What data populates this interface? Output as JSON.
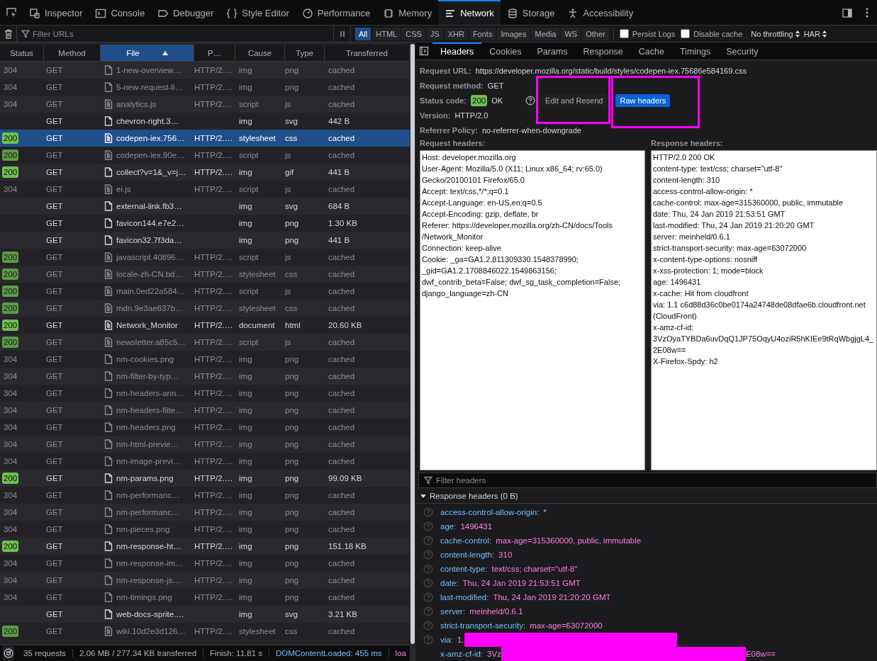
{
  "toolbar": {
    "tabs": [
      {
        "label": "Inspector",
        "selected": false
      },
      {
        "label": "Console",
        "selected": false
      },
      {
        "label": "Debugger",
        "selected": false
      },
      {
        "label": "Style Editor",
        "selected": false
      },
      {
        "label": "Performance",
        "selected": false
      },
      {
        "label": "Memory",
        "selected": false
      },
      {
        "label": "Network",
        "selected": true
      },
      {
        "label": "Storage",
        "selected": false
      },
      {
        "label": "Accessibility",
        "selected": false
      }
    ]
  },
  "filter_bar": {
    "placeholder": "Filter URLs",
    "types": [
      {
        "label": "All",
        "selected": true
      },
      {
        "label": "HTML",
        "selected": false
      },
      {
        "label": "CSS",
        "selected": false
      },
      {
        "label": "JS",
        "selected": false
      },
      {
        "label": "XHR",
        "selected": false
      },
      {
        "label": "Fonts",
        "selected": false
      },
      {
        "label": "Images",
        "selected": false
      },
      {
        "label": "Media",
        "selected": false
      },
      {
        "label": "WS",
        "selected": false
      },
      {
        "label": "Other",
        "selected": false
      }
    ],
    "options": [
      {
        "label": "Persist Logs",
        "checked": false
      },
      {
        "label": "Disable cache",
        "checked": false
      }
    ],
    "throttling": "No throttling",
    "har": "HAR"
  },
  "requests": {
    "columns": [
      {
        "label": "Status",
        "sorted": false
      },
      {
        "label": "Method",
        "sorted": false
      },
      {
        "label": "File",
        "sorted": true
      },
      {
        "label": "P…",
        "sorted": false
      },
      {
        "label": "Cause",
        "sorted": false
      },
      {
        "label": "Type",
        "sorted": false
      },
      {
        "label": "Transferred",
        "sorted": false
      }
    ],
    "rows": [
      {
        "status": "304",
        "badge": false,
        "method": "GET",
        "kind": "image",
        "file": "1-new-overview…",
        "protocol": "HTTP/2.…",
        "cause": "img",
        "type": "png",
        "transferred": "cached",
        "faded": true,
        "selected": false
      },
      {
        "status": "304",
        "badge": false,
        "method": "GET",
        "kind": "image",
        "file": "5-new-request-li…",
        "protocol": "HTTP/2.…",
        "cause": "img",
        "type": "png",
        "transferred": "cached",
        "faded": true,
        "selected": false
      },
      {
        "status": "304",
        "badge": false,
        "method": "GET",
        "kind": "text",
        "file": "analytics.js",
        "protocol": "HTTP/2.…",
        "cause": "script",
        "type": "js",
        "transferred": "cached",
        "faded": true,
        "selected": false
      },
      {
        "status": "",
        "method": "GET",
        "kind": "image",
        "file": "chevron-right.3…",
        "protocol": "",
        "cause": "img",
        "type": "svg",
        "transferred": "442 B",
        "faded": false,
        "selected": false
      },
      {
        "status": "200",
        "badge": true,
        "method": "GET",
        "kind": "text",
        "file": "codepen-iex.756…",
        "protocol": "HTTP/2.…",
        "cause": "stylesheet",
        "type": "css",
        "transferred": "cached",
        "faded": false,
        "selected": true
      },
      {
        "status": "200",
        "badge": true,
        "method": "GET",
        "kind": "text",
        "file": "codepen-iex.90e…",
        "protocol": "HTTP/2.…",
        "cause": "script",
        "type": "js",
        "transferred": "cached",
        "faded": true,
        "selected": false
      },
      {
        "status": "200",
        "badge": true,
        "method": "GET",
        "kind": "image",
        "file": "collect?v=1&_v=j…",
        "protocol": "HTTP/2.…",
        "cause": "img",
        "type": "gif",
        "transferred": "441 B",
        "faded": false,
        "selected": false
      },
      {
        "status": "304",
        "badge": false,
        "method": "GET",
        "kind": "text",
        "file": "ei.js",
        "protocol": "HTTP/2.…",
        "cause": "script",
        "type": "js",
        "transferred": "cached",
        "faded": true,
        "selected": false
      },
      {
        "status": "",
        "method": "GET",
        "kind": "image",
        "file": "external-link.fb3…",
        "protocol": "",
        "cause": "img",
        "type": "svg",
        "transferred": "684 B",
        "faded": false,
        "selected": false
      },
      {
        "status": "",
        "method": "GET",
        "kind": "image",
        "file": "favicon144.e7e2…",
        "protocol": "",
        "cause": "img",
        "type": "png",
        "transferred": "1.30 KB",
        "faded": false,
        "selected": false
      },
      {
        "status": "",
        "method": "GET",
        "kind": "image",
        "file": "favicon32.7f3da…",
        "protocol": "",
        "cause": "img",
        "type": "png",
        "transferred": "441 B",
        "faded": false,
        "selected": false
      },
      {
        "status": "200",
        "badge": true,
        "method": "GET",
        "kind": "text",
        "file": "javascript.40896…",
        "protocol": "HTTP/2.…",
        "cause": "script",
        "type": "js",
        "transferred": "cached",
        "faded": true,
        "selected": false
      },
      {
        "status": "200",
        "badge": true,
        "method": "GET",
        "kind": "text",
        "file": "locale-zh-CN.bd…",
        "protocol": "HTTP/2.…",
        "cause": "stylesheet",
        "type": "css",
        "transferred": "cached",
        "faded": true,
        "selected": false
      },
      {
        "status": "200",
        "badge": true,
        "method": "GET",
        "kind": "text",
        "file": "main.0ed22a584…",
        "protocol": "HTTP/2.…",
        "cause": "script",
        "type": "js",
        "transferred": "cached",
        "faded": true,
        "selected": false
      },
      {
        "status": "200",
        "badge": true,
        "method": "GET",
        "kind": "text",
        "file": "mdn.9e3ae837b…",
        "protocol": "HTTP/2.…",
        "cause": "stylesheet",
        "type": "css",
        "transferred": "cached",
        "faded": true,
        "selected": false
      },
      {
        "status": "200",
        "badge": true,
        "method": "GET",
        "kind": "text",
        "file": "Network_Monitor",
        "protocol": "HTTP/2.…",
        "cause": "document",
        "type": "html",
        "transferred": "20.60 KB",
        "faded": false,
        "selected": false
      },
      {
        "status": "200",
        "badge": true,
        "method": "GET",
        "kind": "text",
        "file": "newsletter.a85c5…",
        "protocol": "HTTP/2.…",
        "cause": "script",
        "type": "js",
        "transferred": "cached",
        "faded": true,
        "selected": false
      },
      {
        "status": "304",
        "badge": false,
        "method": "GET",
        "kind": "image",
        "file": "nm-cookies.png",
        "protocol": "HTTP/2.…",
        "cause": "img",
        "type": "png",
        "transferred": "cached",
        "faded": true,
        "selected": false
      },
      {
        "status": "304",
        "badge": false,
        "method": "GET",
        "kind": "image",
        "file": "nm-filter-by-typ…",
        "protocol": "HTTP/2.…",
        "cause": "img",
        "type": "png",
        "transferred": "cached",
        "faded": true,
        "selected": false
      },
      {
        "status": "304",
        "badge": false,
        "method": "GET",
        "kind": "image",
        "file": "nm-headers-ann…",
        "protocol": "HTTP/2.…",
        "cause": "img",
        "type": "png",
        "transferred": "cached",
        "faded": true,
        "selected": false
      },
      {
        "status": "304",
        "badge": false,
        "method": "GET",
        "kind": "image",
        "file": "nm-headers-filte…",
        "protocol": "HTTP/2.…",
        "cause": "img",
        "type": "png",
        "transferred": "cached",
        "faded": true,
        "selected": false
      },
      {
        "status": "304",
        "badge": false,
        "method": "GET",
        "kind": "image",
        "file": "nm-headers.png",
        "protocol": "HTTP/2.…",
        "cause": "img",
        "type": "png",
        "transferred": "cached",
        "faded": true,
        "selected": false
      },
      {
        "status": "304",
        "badge": false,
        "method": "GET",
        "kind": "image",
        "file": "nm-html-previe…",
        "protocol": "HTTP/2.…",
        "cause": "img",
        "type": "png",
        "transferred": "cached",
        "faded": true,
        "selected": false
      },
      {
        "status": "304",
        "badge": false,
        "method": "GET",
        "kind": "image",
        "file": "nm-image-previ…",
        "protocol": "HTTP/2.…",
        "cause": "img",
        "type": "png",
        "transferred": "cached",
        "faded": true,
        "selected": false
      },
      {
        "status": "200",
        "badge": true,
        "method": "GET",
        "kind": "image",
        "file": "nm-params.png",
        "protocol": "HTTP/2.…",
        "cause": "img",
        "type": "png",
        "transferred": "99.09 KB",
        "faded": false,
        "selected": false
      },
      {
        "status": "304",
        "badge": false,
        "method": "GET",
        "kind": "image",
        "file": "nm-performanc…",
        "protocol": "HTTP/2.…",
        "cause": "img",
        "type": "png",
        "transferred": "cached",
        "faded": true,
        "selected": false
      },
      {
        "status": "304",
        "badge": false,
        "method": "GET",
        "kind": "image",
        "file": "nm-performanc…",
        "protocol": "HTTP/2.…",
        "cause": "img",
        "type": "png",
        "transferred": "cached",
        "faded": true,
        "selected": false
      },
      {
        "status": "304",
        "badge": false,
        "method": "GET",
        "kind": "image",
        "file": "nm-pieces.png",
        "protocol": "HTTP/2.…",
        "cause": "img",
        "type": "png",
        "transferred": "cached",
        "faded": true,
        "selected": false
      },
      {
        "status": "200",
        "badge": true,
        "method": "GET",
        "kind": "image",
        "file": "nm-response-ht…",
        "protocol": "HTTP/2.…",
        "cause": "img",
        "type": "png",
        "transferred": "151.18 KB",
        "faded": false,
        "selected": false
      },
      {
        "status": "304",
        "badge": false,
        "method": "GET",
        "kind": "image",
        "file": "nm-response-im…",
        "protocol": "HTTP/2.…",
        "cause": "img",
        "type": "png",
        "transferred": "cached",
        "faded": true,
        "selected": false
      },
      {
        "status": "304",
        "badge": false,
        "method": "GET",
        "kind": "image",
        "file": "nm-response-js…",
        "protocol": "HTTP/2.…",
        "cause": "img",
        "type": "png",
        "transferred": "cached",
        "faded": true,
        "selected": false
      },
      {
        "status": "304",
        "badge": false,
        "method": "GET",
        "kind": "image",
        "file": "nm-timings.png",
        "protocol": "HTTP/2.…",
        "cause": "img",
        "type": "png",
        "transferred": "cached",
        "faded": true,
        "selected": false
      },
      {
        "status": "",
        "method": "GET",
        "kind": "image",
        "file": "web-docs-sprite.…",
        "protocol": "",
        "cause": "img",
        "type": "svg",
        "transferred": "3.21 KB",
        "faded": false,
        "selected": false
      },
      {
        "status": "200",
        "badge": true,
        "method": "GET",
        "kind": "text",
        "file": "wiki.10d2e3d126…",
        "protocol": "HTTP/2.…",
        "cause": "stylesheet",
        "type": "css",
        "transferred": "cached",
        "faded": true,
        "selected": false
      }
    ]
  },
  "status_bar": {
    "items": [
      {
        "kind": "plain",
        "text": "35 requests"
      },
      {
        "kind": "plain",
        "text": "2.06 MB / 277.34 KB transferred"
      },
      {
        "kind": "plain",
        "text": "Finish: 11.81 s"
      },
      {
        "kind": "dom",
        "text": "DOMContentLoaded: 455 ms"
      },
      {
        "kind": "load",
        "text": "loa"
      }
    ]
  },
  "details": {
    "tabs": [
      {
        "label": "Headers",
        "selected": true
      },
      {
        "label": "Cookies",
        "selected": false
      },
      {
        "label": "Params",
        "selected": false
      },
      {
        "label": "Response",
        "selected": false
      },
      {
        "label": "Cache",
        "selected": false
      },
      {
        "label": "Timings",
        "selected": false
      },
      {
        "label": "Security",
        "selected": false
      }
    ],
    "summary": [
      {
        "kind": "field",
        "label": "Request URL:",
        "value": "https://developer.mozilla.org/static/build/styles/codepen-iex.75686e584169.css"
      },
      {
        "kind": "field",
        "label": "Request method:",
        "value": "GET"
      },
      {
        "kind": "status",
        "label": "Status code:",
        "code": "200",
        "value": "OK",
        "buttons": [
          {
            "label": "Edit and Resend",
            "on": false,
            "highlighted": true
          },
          {
            "label": "Raw headers",
            "on": true,
            "highlighted": true
          }
        ]
      },
      {
        "kind": "field",
        "label": "Version:",
        "value": "HTTP/2.0"
      },
      {
        "kind": "field",
        "label": "Referrer Policy:",
        "value": "no-referrer-when-downgrade"
      }
    ],
    "raw": [
      {
        "title": "Request headers:",
        "text": "Host: developer.mozilla.org\nUser-Agent: Mozilla/5.0 (X11; Linux x86_64; rv:65.0)\nGecko/20100101 Firefox/65.0\nAccept: text/css,*/*;q=0.1\nAccept-Language: en-US,en;q=0.5\nAccept-Encoding: gzip, deflate, br\nReferer: https://developer.mozilla.org/zh-CN/docs/Tools\n/Network_Monitor\nConnection: keep-alive\nCookie: _ga=GA1.2.811309330.1548378990;\n_gid=GA1.2.1708846022.1549863156;\ndwf_contrib_beta=False; dwf_sg_task_completion=False;\ndjango_language=zh-CN"
      },
      {
        "title": "Response headers:",
        "text": "HTTP/2.0 200 OK\ncontent-type: text/css; charset=\"utf-8\"\ncontent-length: 310\naccess-control-allow-origin: *\ncache-control: max-age=315360000, public, immutable\ndate: Thu, 24 Jan 2019 21:53:51 GMT\nlast-modified: Thu, 24 Jan 2019 21:20:20 GMT\nserver: meinheld/0.6.1\nstrict-transport-security: max-age=63072000\nx-content-type-options: nosniff\nx-xss-protection: 1; mode=block\nage: 1496431\nx-cache: Hit from cloudfront\nvia: 1.1 c6d88d36c0be0174a24748de08dfae6b.cloudfront.net\n(CloudFront)\nx-amz-cf-id:\n3VzOyaTYBDa6uvDqQ1JP75OqyU4oziR5hKIEe9tRqWbgjgL4_\n2E08w==\nX-Firefox-Spdy: h2"
      }
    ],
    "filter_placeholder": "Filter headers",
    "section": {
      "title": "Response headers (0 B)",
      "expanded": true
    },
    "headers": [
      {
        "name": "access-control-allow-origin:",
        "value": "*",
        "help": true,
        "redacted": false
      },
      {
        "name": "age:",
        "value": "1496431",
        "help": true,
        "redacted": false
      },
      {
        "name": "cache-control:",
        "value": "max-age=315360000, public, immutable",
        "help": true,
        "redacted": false
      },
      {
        "name": "content-length:",
        "value": "310",
        "help": true,
        "redacted": false
      },
      {
        "name": "content-type:",
        "value": "text/css; charset=\"utf-8\"",
        "help": true,
        "redacted": false
      },
      {
        "name": "date:",
        "value": "Thu, 24 Jan 2019 21:53:51 GMT",
        "help": true,
        "redacted": false
      },
      {
        "name": "last-modified:",
        "value": "Thu, 24 Jan 2019 21:20:20 GMT",
        "help": true,
        "redacted": false
      },
      {
        "name": "server:",
        "value": "meinheld/0.6.1",
        "help": true,
        "redacted": false
      },
      {
        "name": "strict-transport-security:",
        "value": "max-age=63072000",
        "help": true,
        "redacted": false
      },
      {
        "name": "via:",
        "value": "1.",
        "help": true,
        "redacted": true
      },
      {
        "name": "x-amz-cf-id:",
        "value": "3Vz",
        "value_end": "E08w==",
        "help": false,
        "redacted": true
      }
    ]
  }
}
